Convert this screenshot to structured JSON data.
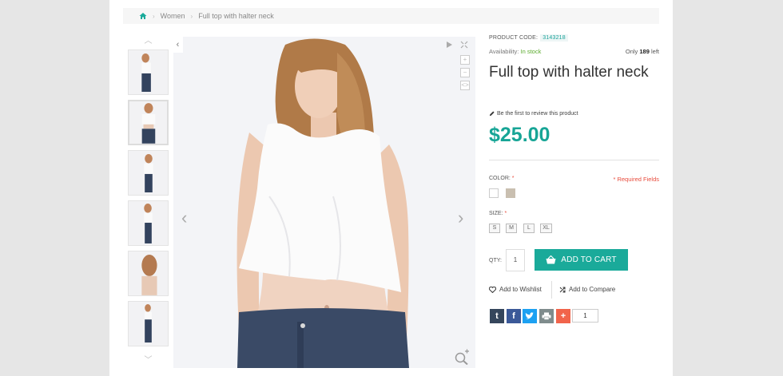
{
  "breadcrumb": {
    "home_icon": "home-icon",
    "items": [
      "Women",
      "Full top with halter neck"
    ]
  },
  "gallery": {
    "thumbnails_count": 6,
    "active_thumbnail": 2,
    "up_arrow": "chevron-up-icon",
    "down_arrow": "chevron-down-icon"
  },
  "viewer": {
    "prev": "‹",
    "next": "›",
    "prev_tab": "‹",
    "play_icon": "play-icon",
    "expand_icon": "fullscreen-icon",
    "zoom_in": "+",
    "zoom_out": "−",
    "zoom_reset": "<>",
    "magnifier_icon": "zoom-icon"
  },
  "product": {
    "code_label": "PRODUCT CODE:",
    "code": "3143218",
    "availability_label": "Availability:",
    "availability": "In stock",
    "only_prefix": "Only",
    "only_count": "189",
    "only_suffix": "left",
    "title": "Full top with halter neck",
    "review_link": "Be the first to review this product",
    "price": "$25.00",
    "color_label": "COLOR:",
    "required_star": "*",
    "required_fields": "* Required Fields",
    "colors": [
      "#ffffff",
      "#c9bfb0"
    ],
    "size_label": "SIZE:",
    "sizes": [
      "S",
      "M",
      "L",
      "XL"
    ],
    "qty_label": "QTY:",
    "qty": "1",
    "add_to_cart": "ADD TO CART",
    "wishlist": "Add to Wishlist",
    "compare": "Add to Compare",
    "share": [
      {
        "icon": "tumblr-icon",
        "glyph": "t",
        "color": "#35465c"
      },
      {
        "icon": "facebook-icon",
        "glyph": "f",
        "color": "#3b5998"
      },
      {
        "icon": "twitter-icon",
        "glyph": "t",
        "color": "#1da1f2"
      },
      {
        "icon": "print-icon",
        "glyph": "⎙",
        "color": "#7f8c8d"
      },
      {
        "icon": "addthis-icon",
        "glyph": "+",
        "color": "#f1644b"
      }
    ],
    "share_count": "1"
  },
  "colors": {
    "accent": "#1aaa9a",
    "price": "#17a596",
    "in_stock": "#5aaa2c",
    "required": "#e84c3d"
  }
}
